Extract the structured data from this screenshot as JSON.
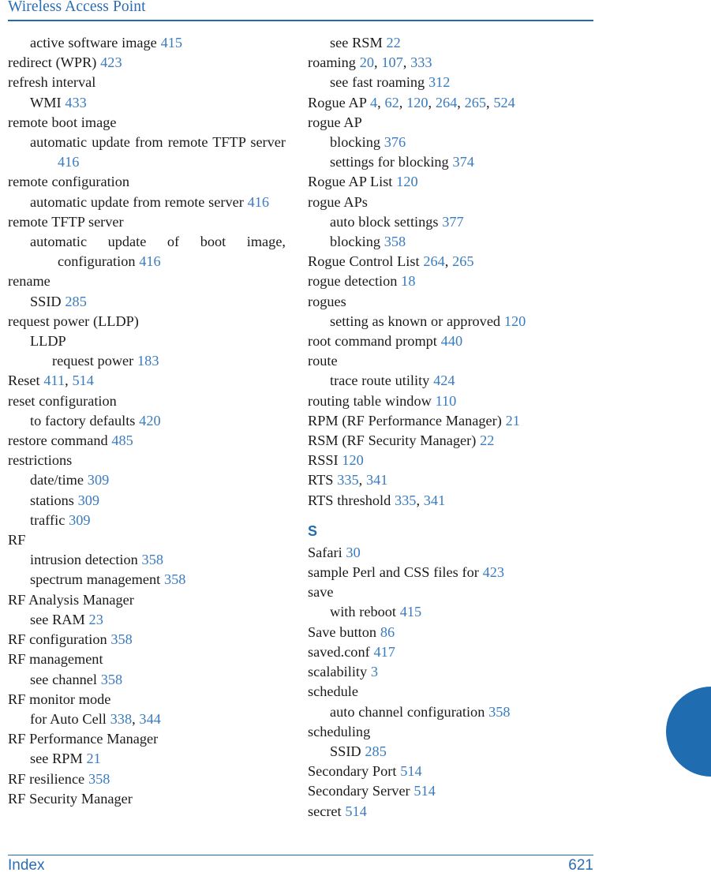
{
  "header": {
    "title": "Wireless Access Point"
  },
  "footer": {
    "label": "Index",
    "page_number": "621"
  },
  "colors": {
    "accent_blue": "#1f6cb0",
    "header_blue": "#2a6db0",
    "page_ref_blue": "#3a7cc0",
    "body_text": "#1b1b1b",
    "background": "#ffffff"
  },
  "thumb_tab": {
    "name": "section-thumb-tab",
    "shape": "half-circle",
    "color": "#1f6cb0"
  },
  "columns": {
    "left": [
      {
        "level": 1,
        "justified": false,
        "text": "active software image 415"
      },
      {
        "level": 0,
        "justified": false,
        "text": "redirect (WPR) 423"
      },
      {
        "level": 0,
        "justified": false,
        "text": "refresh interval"
      },
      {
        "level": 1,
        "justified": false,
        "text": "WMI 433"
      },
      {
        "level": 0,
        "justified": false,
        "text": "remote boot image"
      },
      {
        "level": 1,
        "justified": true,
        "text": "automatic update from remote TFTP server 416"
      },
      {
        "level": 0,
        "justified": false,
        "text": "remote configuration"
      },
      {
        "level": 1,
        "justified": true,
        "text": "automatic update from remote server 416"
      },
      {
        "level": 0,
        "justified": false,
        "text": "remote TFTP server"
      },
      {
        "level": 1,
        "justified": true,
        "text": "automatic update of boot image, configuration 416"
      },
      {
        "level": 0,
        "justified": false,
        "text": "rename"
      },
      {
        "level": 1,
        "justified": false,
        "text": "SSID 285"
      },
      {
        "level": 0,
        "justified": false,
        "text": "request power (LLDP)"
      },
      {
        "level": 1,
        "justified": false,
        "text": "LLDP"
      },
      {
        "level": 2,
        "justified": false,
        "text": "request power 183"
      },
      {
        "level": 0,
        "justified": false,
        "text": "Reset 411, 514"
      },
      {
        "level": 0,
        "justified": false,
        "text": "reset configuration"
      },
      {
        "level": 1,
        "justified": false,
        "text": "to factory defaults 420"
      },
      {
        "level": 0,
        "justified": false,
        "text": "restore command 485"
      },
      {
        "level": 0,
        "justified": false,
        "text": "restrictions"
      },
      {
        "level": 1,
        "justified": false,
        "text": "date/time 309"
      },
      {
        "level": 1,
        "justified": false,
        "text": "stations 309"
      },
      {
        "level": 1,
        "justified": false,
        "text": "traffic 309"
      },
      {
        "level": 0,
        "justified": false,
        "text": "RF"
      },
      {
        "level": 1,
        "justified": false,
        "text": "intrusion detection 358"
      },
      {
        "level": 1,
        "justified": false,
        "text": "spectrum management 358"
      },
      {
        "level": 0,
        "justified": false,
        "text": "RF Analysis Manager"
      },
      {
        "level": 1,
        "justified": false,
        "text": "see RAM 23"
      },
      {
        "level": 0,
        "justified": false,
        "text": "RF configuration 358"
      },
      {
        "level": 0,
        "justified": false,
        "text": "RF management"
      },
      {
        "level": 1,
        "justified": false,
        "text": "see channel 358"
      },
      {
        "level": 0,
        "justified": false,
        "text": "RF monitor mode"
      },
      {
        "level": 1,
        "justified": false,
        "text": "for Auto Cell 338, 344"
      },
      {
        "level": 0,
        "justified": false,
        "text": "RF Performance Manager"
      },
      {
        "level": 1,
        "justified": false,
        "text": "see RPM 21"
      },
      {
        "level": 0,
        "justified": false,
        "text": "RF resilience 358"
      },
      {
        "level": 0,
        "justified": false,
        "text": "RF Security Manager"
      }
    ],
    "right_before_s": [
      {
        "level": 1,
        "justified": false,
        "text": "see RSM 22"
      },
      {
        "level": 0,
        "justified": false,
        "text": "roaming 20, 107, 333"
      },
      {
        "level": 1,
        "justified": false,
        "text": "see fast roaming 312"
      },
      {
        "level": 0,
        "justified": false,
        "text": "Rogue AP 4, 62, 120, 264, 265, 524"
      },
      {
        "level": 0,
        "justified": false,
        "text": "rogue AP"
      },
      {
        "level": 1,
        "justified": false,
        "text": "blocking 376"
      },
      {
        "level": 1,
        "justified": false,
        "text": "settings for blocking 374"
      },
      {
        "level": 0,
        "justified": false,
        "text": "Rogue AP List 120"
      },
      {
        "level": 0,
        "justified": false,
        "text": "rogue APs"
      },
      {
        "level": 1,
        "justified": false,
        "text": "auto block settings 377"
      },
      {
        "level": 1,
        "justified": false,
        "text": "blocking 358"
      },
      {
        "level": 0,
        "justified": false,
        "text": "Rogue Control List 264, 265"
      },
      {
        "level": 0,
        "justified": false,
        "text": "rogue detection 18"
      },
      {
        "level": 0,
        "justified": false,
        "text": "rogues"
      },
      {
        "level": 1,
        "justified": false,
        "text": "setting as known or approved 120"
      },
      {
        "level": 0,
        "justified": false,
        "text": "root command prompt 440"
      },
      {
        "level": 0,
        "justified": false,
        "text": "route"
      },
      {
        "level": 1,
        "justified": false,
        "text": "trace route utility 424"
      },
      {
        "level": 0,
        "justified": false,
        "text": "routing table window 110"
      },
      {
        "level": 0,
        "justified": false,
        "text": "RPM (RF Performance Manager) 21"
      },
      {
        "level": 0,
        "justified": false,
        "text": "RSM (RF Security Manager) 22"
      },
      {
        "level": 0,
        "justified": false,
        "text": "RSSI 120"
      },
      {
        "level": 0,
        "justified": false,
        "text": "RTS 335, 341"
      },
      {
        "level": 0,
        "justified": false,
        "text": "RTS threshold 335, 341"
      }
    ],
    "right_letter_heading": "S",
    "right_after_s": [
      {
        "level": 0,
        "justified": false,
        "text": "Safari 30"
      },
      {
        "level": 0,
        "justified": false,
        "text": "sample Perl and CSS files for 423"
      },
      {
        "level": 0,
        "justified": false,
        "text": "save"
      },
      {
        "level": 1,
        "justified": false,
        "text": "with reboot 415"
      },
      {
        "level": 0,
        "justified": false,
        "text": "Save button 86"
      },
      {
        "level": 0,
        "justified": false,
        "text": "saved.conf 417"
      },
      {
        "level": 0,
        "justified": false,
        "text": "scalability 3"
      },
      {
        "level": 0,
        "justified": false,
        "text": "schedule"
      },
      {
        "level": 1,
        "justified": false,
        "text": "auto channel configuration 358"
      },
      {
        "level": 0,
        "justified": false,
        "text": "scheduling"
      },
      {
        "level": 1,
        "justified": false,
        "text": "SSID 285"
      },
      {
        "level": 0,
        "justified": false,
        "text": "Secondary Port 514"
      },
      {
        "level": 0,
        "justified": false,
        "text": "Secondary Server 514"
      },
      {
        "level": 0,
        "justified": false,
        "text": "secret 514"
      }
    ]
  }
}
